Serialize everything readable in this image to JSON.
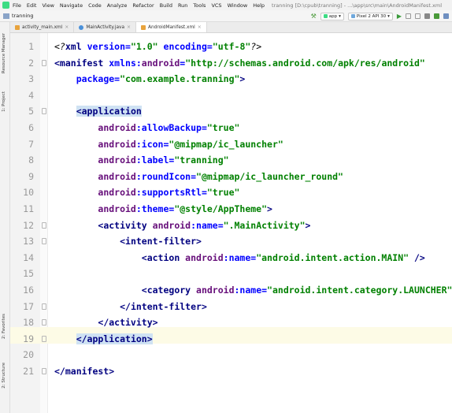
{
  "menubar": {
    "items": [
      "File",
      "Edit",
      "View",
      "Navigate",
      "Code",
      "Analyze",
      "Refactor",
      "Build",
      "Run",
      "Tools",
      "VCS",
      "Window",
      "Help"
    ],
    "window_title": "tranning [D:\\cpub\\tranning] - ...\\app\\src\\main\\AndroidManifest.xml"
  },
  "navbar": {
    "project": "tranning",
    "run_config": "app",
    "device": "Pixel 2 API 30"
  },
  "left_strip": {
    "tabs": [
      "Resource Manager",
      "1: Project",
      "2: Favorites",
      "2: Structure"
    ]
  },
  "tabs": [
    {
      "label": "activity_main.xml",
      "icon": "xml-layout-icon",
      "color": "#e8a33c",
      "active": false
    },
    {
      "label": "MainActivity.java",
      "icon": "java-class-icon",
      "color": "#4a90d9",
      "active": false
    },
    {
      "label": "AndroidManifest.xml",
      "icon": "manifest-icon",
      "color": "#e8a33c",
      "active": true
    }
  ],
  "editor": {
    "current_line": 19,
    "lines": [
      [
        {
          "t": "<?",
          "c": "t-decl"
        },
        {
          "t": "xml ",
          "c": "t-tag"
        },
        {
          "t": "version=",
          "c": "t-attr"
        },
        {
          "t": "\"1.0\"",
          "c": "t-str"
        },
        {
          "t": " ",
          "c": ""
        },
        {
          "t": "encoding=",
          "c": "t-attr"
        },
        {
          "t": "\"utf-8\"",
          "c": "t-str"
        },
        {
          "t": "?>",
          "c": "t-decl"
        }
      ],
      [
        {
          "t": "<manifest ",
          "c": "t-tag"
        },
        {
          "t": "xmlns:",
          "c": "t-attr"
        },
        {
          "t": "android",
          "c": "t-ns"
        },
        {
          "t": "=",
          "c": "t-attr"
        },
        {
          "t": "\"http://schemas.android.com/apk/res/android\"",
          "c": "t-str"
        }
      ],
      [
        {
          "t": "    ",
          "c": ""
        },
        {
          "t": "package=",
          "c": "t-attr"
        },
        {
          "t": "\"com.example.tranning\"",
          "c": "t-str"
        },
        {
          "t": ">",
          "c": "t-tag"
        }
      ],
      [],
      [
        {
          "t": "    ",
          "c": ""
        },
        {
          "t": "<application",
          "c": "t-tag hl"
        }
      ],
      [
        {
          "t": "        ",
          "c": ""
        },
        {
          "t": "android",
          "c": "t-ns"
        },
        {
          "t": ":allowBackup=",
          "c": "t-attr"
        },
        {
          "t": "\"true\"",
          "c": "t-str"
        }
      ],
      [
        {
          "t": "        ",
          "c": ""
        },
        {
          "t": "android",
          "c": "t-ns"
        },
        {
          "t": ":icon=",
          "c": "t-attr"
        },
        {
          "t": "\"@mipmap/ic_launcher\"",
          "c": "t-str"
        }
      ],
      [
        {
          "t": "        ",
          "c": ""
        },
        {
          "t": "android",
          "c": "t-ns"
        },
        {
          "t": ":label=",
          "c": "t-attr"
        },
        {
          "t": "\"tranning\"",
          "c": "t-str"
        }
      ],
      [
        {
          "t": "        ",
          "c": ""
        },
        {
          "t": "android",
          "c": "t-ns"
        },
        {
          "t": ":roundIcon=",
          "c": "t-attr"
        },
        {
          "t": "\"@mipmap/ic_launcher_round\"",
          "c": "t-str"
        }
      ],
      [
        {
          "t": "        ",
          "c": ""
        },
        {
          "t": "android",
          "c": "t-ns"
        },
        {
          "t": ":supportsRtl=",
          "c": "t-attr"
        },
        {
          "t": "\"true\"",
          "c": "t-str"
        }
      ],
      [
        {
          "t": "        ",
          "c": ""
        },
        {
          "t": "android",
          "c": "t-ns"
        },
        {
          "t": ":theme=",
          "c": "t-attr"
        },
        {
          "t": "\"@style/AppTheme\"",
          "c": "t-str"
        },
        {
          "t": ">",
          "c": "t-tag"
        }
      ],
      [
        {
          "t": "        ",
          "c": ""
        },
        {
          "t": "<activity ",
          "c": "t-tag"
        },
        {
          "t": "android",
          "c": "t-ns"
        },
        {
          "t": ":name=",
          "c": "t-attr"
        },
        {
          "t": "\".MainActivity\"",
          "c": "t-str"
        },
        {
          "t": ">",
          "c": "t-tag"
        }
      ],
      [
        {
          "t": "            ",
          "c": ""
        },
        {
          "t": "<intent-filter>",
          "c": "t-tag"
        }
      ],
      [
        {
          "t": "                ",
          "c": ""
        },
        {
          "t": "<action ",
          "c": "t-tag"
        },
        {
          "t": "android",
          "c": "t-ns"
        },
        {
          "t": ":name=",
          "c": "t-attr"
        },
        {
          "t": "\"android.intent.action.MAIN\"",
          "c": "t-str"
        },
        {
          "t": " />",
          "c": "t-tag"
        }
      ],
      [],
      [
        {
          "t": "                ",
          "c": ""
        },
        {
          "t": "<category ",
          "c": "t-tag"
        },
        {
          "t": "android",
          "c": "t-ns"
        },
        {
          "t": ":name=",
          "c": "t-attr"
        },
        {
          "t": "\"android.intent.category.LAUNCHER\"",
          "c": "t-str"
        },
        {
          "t": " />",
          "c": "t-tag"
        }
      ],
      [
        {
          "t": "            ",
          "c": ""
        },
        {
          "t": "</intent-filter>",
          "c": "t-tag"
        }
      ],
      [
        {
          "t": "        ",
          "c": ""
        },
        {
          "t": "</activity>",
          "c": "t-tag"
        }
      ],
      [
        {
          "t": "    ",
          "c": ""
        },
        {
          "t": "</application>",
          "c": "t-tag hl"
        }
      ],
      [],
      [
        {
          "t": "</manifest>",
          "c": "t-tag"
        }
      ]
    ]
  }
}
